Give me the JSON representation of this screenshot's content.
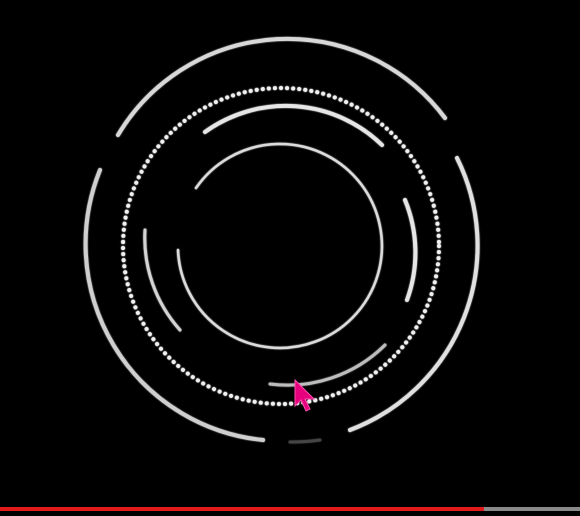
{
  "player": {
    "progress_fraction": 0.835,
    "colors": {
      "background": "#000000",
      "rings": "#e8e8e8",
      "progress_played": "#e11a1a",
      "progress_track": "#8a8a8a",
      "cursor": "#e6007e"
    }
  },
  "icons": {
    "cursor": "mouse-pointer-icon"
  }
}
